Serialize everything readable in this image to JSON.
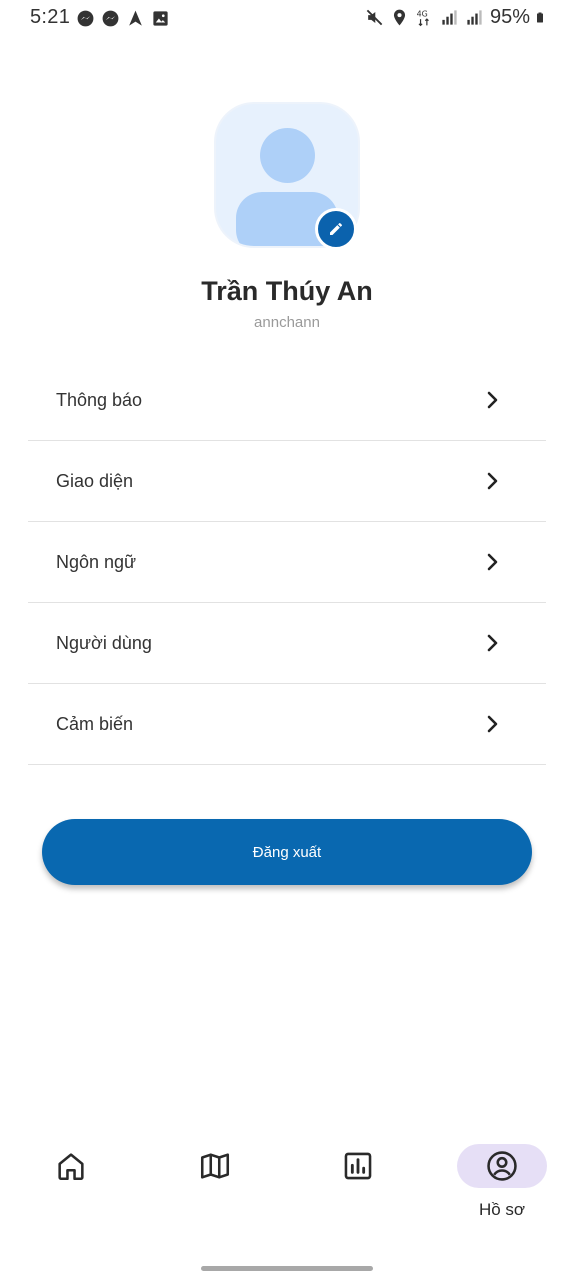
{
  "status_bar": {
    "time": "5:21",
    "battery": "95%",
    "left_icons": [
      "messenger-icon",
      "messenger-icon",
      "navigation-icon",
      "image-icon"
    ],
    "right_icons": [
      "mute-icon",
      "location-icon",
      "4g-icon",
      "signal-icon",
      "signal-icon",
      "battery-icon"
    ]
  },
  "profile": {
    "name": "Trần Thúy An",
    "username": "annchann"
  },
  "menu": {
    "items": [
      {
        "label": "Thông báo"
      },
      {
        "label": "Giao diện"
      },
      {
        "label": "Ngôn ngữ"
      },
      {
        "label": "Người dùng"
      },
      {
        "label": "Cảm biến"
      }
    ]
  },
  "actions": {
    "logout_label": "Đăng xuất"
  },
  "bottom_nav": {
    "items": [
      {
        "icon": "home-icon",
        "label": ""
      },
      {
        "icon": "map-icon",
        "label": ""
      },
      {
        "icon": "chart-icon",
        "label": ""
      },
      {
        "icon": "profile-icon",
        "label": "Hồ sơ",
        "active": true
      }
    ]
  },
  "colors": {
    "primary": "#0968b0",
    "avatar_bg": "#e7f1fd",
    "avatar_fg": "#aed0f8",
    "nav_active_bg": "#e6dff6"
  }
}
